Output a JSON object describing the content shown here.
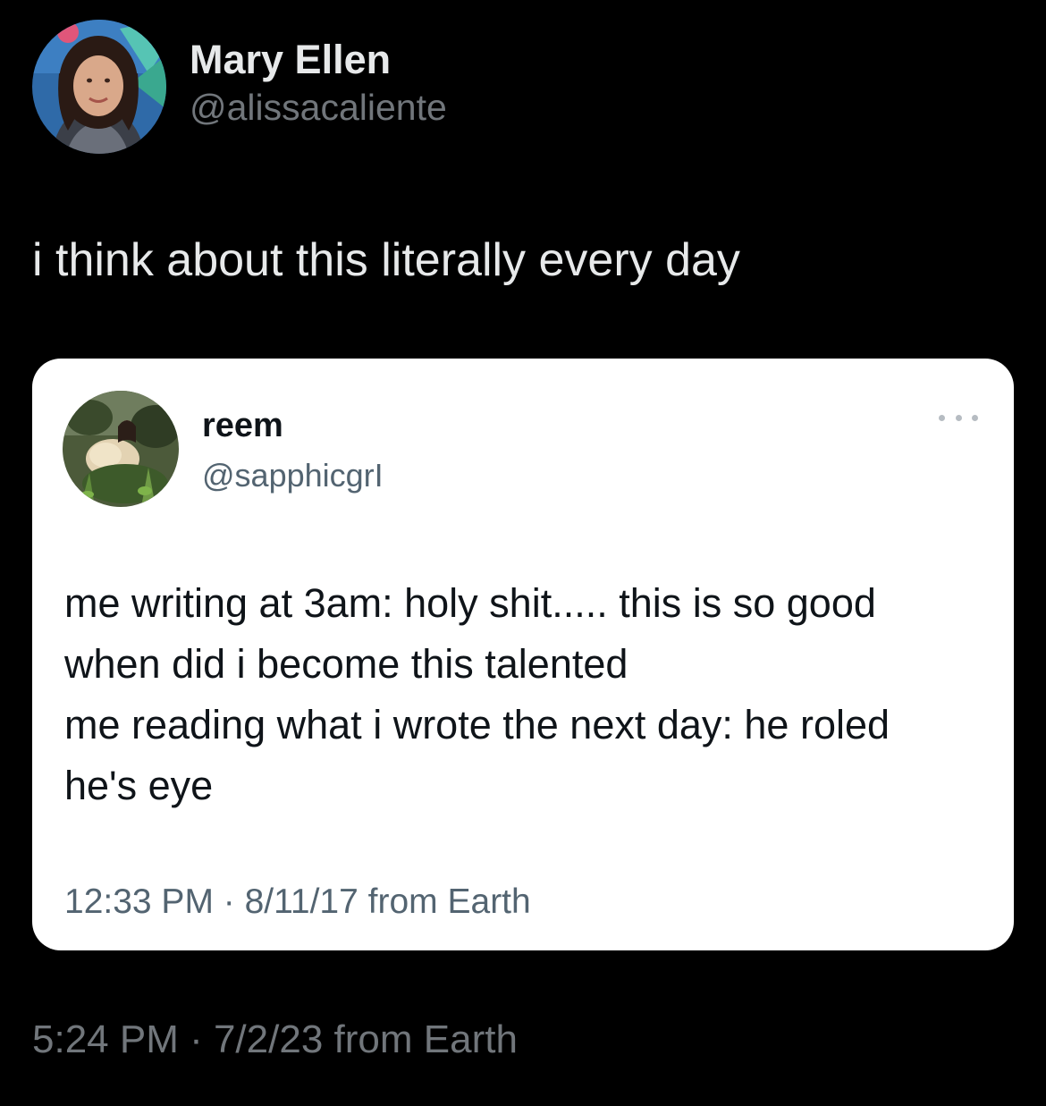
{
  "outer_tweet": {
    "display_name": "Mary Ellen",
    "handle": "@alissacaliente",
    "text": "i think about this literally every day",
    "timestamp": "5:24 PM · 7/2/23 from Earth",
    "avatar_icon": "profile-photo-woman-curly-hair"
  },
  "quoted_tweet": {
    "display_name": "reem",
    "handle": "@sapphicgrI",
    "lines": [
      "me writing at 3am: holy shit..... this is so good",
      "when did i become this talented",
      "me reading what i wrote the next day: he roled",
      "he's eye"
    ],
    "timestamp": "12:33 PM · 8/11/17 from Earth",
    "more_icon": "ellipsis-icon",
    "avatar_icon": "profile-photo-garden"
  },
  "colors": {
    "background": "#000000",
    "primary_text_dark": "#e7e9ea",
    "secondary_text_dark": "#71767b",
    "card_background": "#ffffff",
    "primary_text_light": "#0f1419",
    "secondary_text_light": "#536471"
  }
}
